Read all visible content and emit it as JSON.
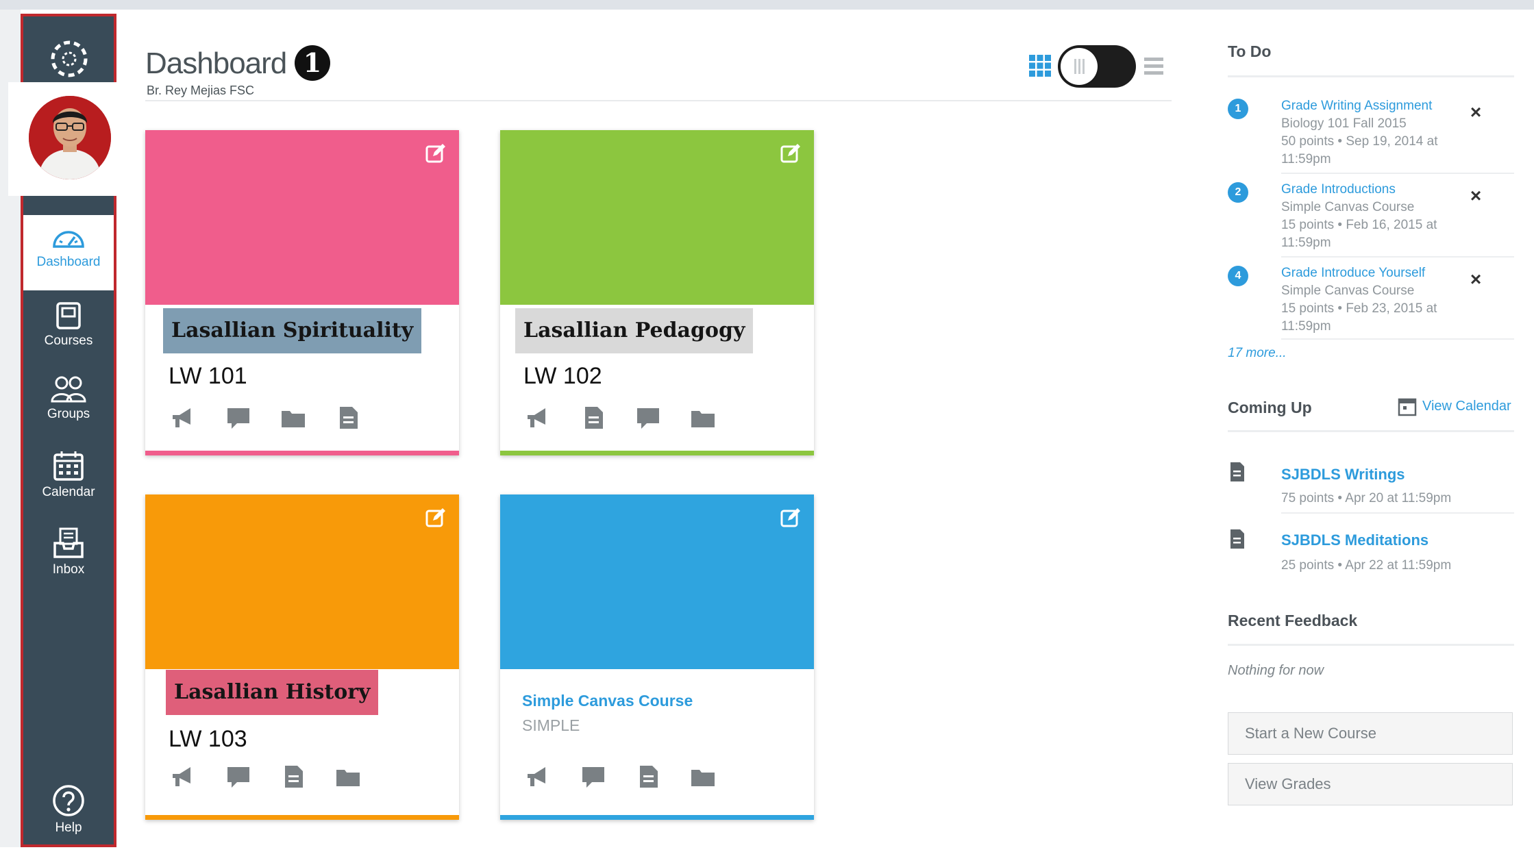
{
  "header": {
    "title": "Dashboard",
    "badge": "1",
    "subtitle": "Br. Rey Mejias  FSC"
  },
  "nav": {
    "items": [
      {
        "label": "Dashboard",
        "icon": "dashboard-icon",
        "active": true
      },
      {
        "label": "Courses",
        "icon": "courses-icon"
      },
      {
        "label": "Groups",
        "icon": "groups-icon"
      },
      {
        "label": "Calendar",
        "icon": "calendar-icon"
      },
      {
        "label": "Inbox",
        "icon": "inbox-icon"
      }
    ],
    "help": {
      "label": "Help",
      "icon": "help-icon"
    }
  },
  "cards": [
    {
      "tag": "Lasallian Spirituality",
      "code": "LW 101",
      "color": "#f05d8c",
      "tag_bg": "#7f9db2",
      "bar": "#f05d8c"
    },
    {
      "tag": "Lasallian Pedagogy",
      "code": "LW 102",
      "color": "#8cc63f",
      "tag_bg": "#d9d9d9",
      "bar": "#8cc63f"
    },
    {
      "tag": "Lasallian History",
      "code": "LW 103",
      "color": "#f89a09",
      "tag_bg": "#df5f7a",
      "bar": "#f89a09"
    },
    {
      "title": "Simple Canvas Course",
      "subtitle": "SIMPLE",
      "color": "#2fa4df",
      "bar": "#2fa4df"
    }
  ],
  "todo": {
    "heading": "To Do",
    "items": [
      {
        "num": "1",
        "title": "Grade Writing Assignment",
        "meta": "Biology 101 Fall 2015\n50 points • Sep 19, 2014 at 11:59pm"
      },
      {
        "num": "2",
        "title": "Grade Introductions",
        "meta": "Simple Canvas Course\n15 points • Feb 16, 2015 at 11:59pm"
      },
      {
        "num": "4",
        "title": "Grade Introduce Yourself",
        "meta": "Simple Canvas Course\n15 points • Feb 23, 2015 at 11:59pm"
      }
    ],
    "more": "17 more..."
  },
  "coming_up": {
    "heading": "Coming Up",
    "calendar_link": "View Calendar",
    "items": [
      {
        "title": "SJBDLS Writings",
        "meta": "75 points • Apr 20 at 11:59pm"
      },
      {
        "title": "SJBDLS Meditations",
        "meta": "25 points • Apr 22 at 11:59pm"
      }
    ]
  },
  "feedback": {
    "heading": "Recent Feedback",
    "empty": "Nothing for now"
  },
  "buttons": {
    "new_course": "Start a New Course",
    "view_grades": "View Grades"
  },
  "colors": {
    "nav_bg": "#394b58",
    "nav_border": "#c0282d",
    "link": "#2d9bdc"
  }
}
